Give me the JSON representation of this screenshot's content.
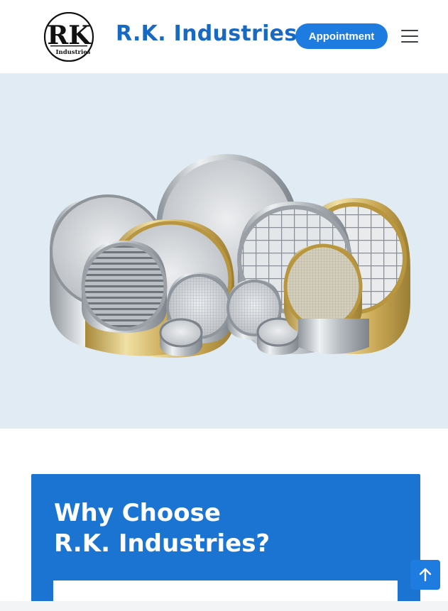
{
  "header": {
    "logo_text": "RK",
    "logo_subtext": "Industries",
    "brand_name": "R.K. Industries",
    "appointment_label": "Appointment",
    "menu_icon": "hamburger-menu-icon"
  },
  "hero": {
    "image_subject": "test-sieves-image"
  },
  "why_section": {
    "title_line1": "Why Choose",
    "title_line2": "R.K. Industries?"
  },
  "colors": {
    "primary": "#1e7ce0",
    "brand_text": "#1769c4",
    "hero_bg": "#e1ebf4",
    "card_bg": "#1b74d2"
  },
  "icons": {
    "scroll_top": "arrow-up-icon",
    "bottom_handle": "drag-handle-icon"
  }
}
